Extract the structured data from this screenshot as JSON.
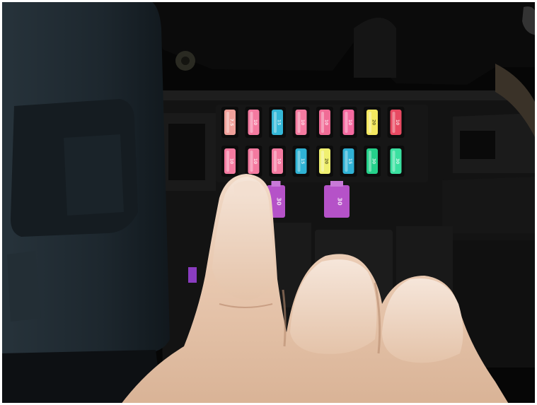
{
  "scene": {
    "background": "#050505",
    "panel_color": "#1c252b",
    "fuse_box_color": "#141414",
    "skin_color": "#e8c9b0"
  },
  "fuses": {
    "top_row": [
      {
        "label": "7.5",
        "color": "#f0a09a"
      },
      {
        "label": "10",
        "color": "#f47aa0"
      },
      {
        "label": "15",
        "color": "#35b8d8"
      },
      {
        "label": "10",
        "color": "#f47aa0"
      },
      {
        "label": "10",
        "color": "#f06c96"
      },
      {
        "label": "10",
        "color": "#f46aa0"
      },
      {
        "label": "20",
        "color": "#f4e860"
      },
      {
        "label": "10",
        "color": "#e84a62"
      }
    ],
    "bottom_row": [
      {
        "label": "10",
        "color": "#f47aa0"
      },
      {
        "label": "10",
        "color": "#f47aa0"
      },
      {
        "label": "10",
        "color": "#f47aa0"
      },
      {
        "label": "15",
        "color": "#2fb2d4"
      },
      {
        "label": "20",
        "color": "#f0f070"
      },
      {
        "label": "15",
        "color": "#30b2d6"
      },
      {
        "label": "30",
        "color": "#25d08a"
      },
      {
        "label": "30",
        "color": "#3ae0a0"
      }
    ]
  },
  "maxi_fuses": [
    {
      "label": "30",
      "color": "#b552c8"
    },
    {
      "label": "30",
      "color": "#b552c8"
    }
  ]
}
